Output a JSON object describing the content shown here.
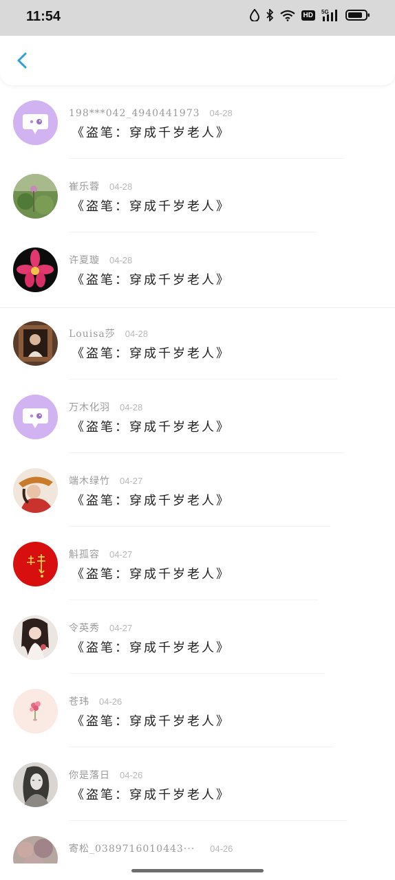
{
  "status_bar": {
    "time": "11:54",
    "network_badge": "HD",
    "signal_label": "5G"
  },
  "header": {
    "back_icon": "chevron-left-icon",
    "accent_color": "#2f9fd8"
  },
  "comments": [
    {
      "name": "198***042_4940441973",
      "date": "04-28",
      "message": "《盗笔：穿成千岁老人》",
      "avatar_icon": "default-chat-avatar"
    },
    {
      "name": "崔乐蓉",
      "date": "04-28",
      "message": "《盗笔：穿成千岁老人》",
      "avatar_icon": "plant-photo-avatar"
    },
    {
      "name": "许夏璇",
      "date": "04-28",
      "message": "《盗笔：穿成千岁老人》",
      "avatar_icon": "pink-orchid-avatar"
    },
    {
      "name": "Louisa莎",
      "date": "04-28",
      "message": "《盗笔：穿成千岁老人》",
      "avatar_icon": "person-in-window-avatar"
    },
    {
      "name": "万木化羽",
      "date": "04-28",
      "message": "《盗笔：穿成千岁老人》",
      "avatar_icon": "default-chat-avatar"
    },
    {
      "name": "端木绿竹",
      "date": "04-27",
      "message": "《盗笔：穿成千岁老人》",
      "avatar_icon": "girl-with-hat-avatar"
    },
    {
      "name": "斛孤容",
      "date": "04-27",
      "message": "《盗笔：穿成千岁老人》",
      "avatar_icon": "red-calligraphy-avatar"
    },
    {
      "name": "令英秀",
      "date": "04-27",
      "message": "《盗笔：穿成千岁老人》",
      "avatar_icon": "girl-portrait-avatar"
    },
    {
      "name": "苍玮",
      "date": "04-26",
      "message": "《盗笔：穿成千岁老人》",
      "avatar_icon": "pink-flower-avatar"
    },
    {
      "name": "你是落日",
      "date": "04-26",
      "message": "《盗笔：穿成千岁老人》",
      "avatar_icon": "sketch-portrait-avatar"
    },
    {
      "name": "寄松_0389716010443···",
      "date": "04-26",
      "message": "",
      "avatar_icon": "stone-texture-avatar"
    }
  ]
}
